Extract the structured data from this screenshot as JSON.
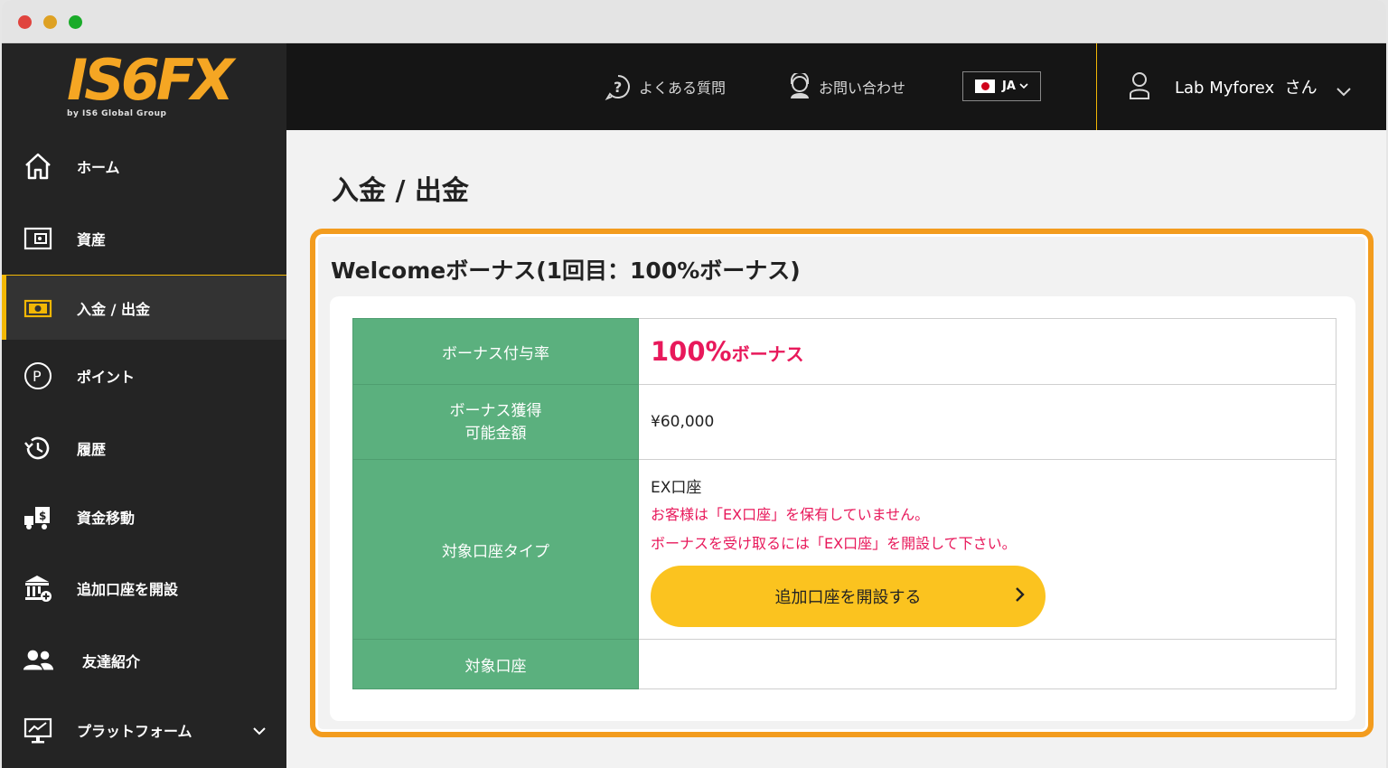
{
  "logo": {
    "text": "IS6FX",
    "subtitle": "by IS6 Global Group"
  },
  "sidebar": {
    "items": [
      {
        "label": "ホーム",
        "icon": "home-icon"
      },
      {
        "label": "資産",
        "icon": "wallet-icon"
      },
      {
        "label": "入金 / 出金",
        "icon": "money-icon",
        "active": true
      },
      {
        "label": "ポイント",
        "icon": "point-icon"
      },
      {
        "label": "履歴",
        "icon": "history-icon"
      },
      {
        "label": "資金移動",
        "icon": "fund-transfer-icon"
      },
      {
        "label": "追加口座を開設",
        "icon": "bank-add-icon"
      },
      {
        "label": "友達紹介",
        "icon": "users-icon"
      },
      {
        "label": "プラットフォーム",
        "icon": "platform-icon"
      }
    ]
  },
  "header": {
    "faq_label": "よくある質問",
    "contact_label": "お問い合わせ",
    "language": "JA",
    "user_name": "Lab Myforex",
    "honorific": "さん"
  },
  "main": {
    "page_title": "入金 / 出金",
    "card_title": "Welcomeボーナス(1回目：100%ボーナス)",
    "rows": {
      "rate_label": "ボーナス付与率",
      "rate_value": "100%",
      "rate_suffix": "ボーナス",
      "max_label_1": "ボーナス獲得",
      "max_label_2": "可能金額",
      "max_value": "¥60,000",
      "type_label": "対象口座タイプ",
      "type_value": "EX口座",
      "warning_1": "お客様は「EX口座」を保有していません。",
      "warning_2": "ボーナスを受け取るには「EX口座」を開設して下さい。",
      "open_button": "追加口座を開設する",
      "account_label": "対象口座",
      "account_value": ""
    }
  },
  "colors": {
    "accent": "#f2b705",
    "highlight_border": "#f39c1e",
    "table_header": "#5bb07e",
    "warning": "#e8195b",
    "button": "#fbc31f"
  }
}
